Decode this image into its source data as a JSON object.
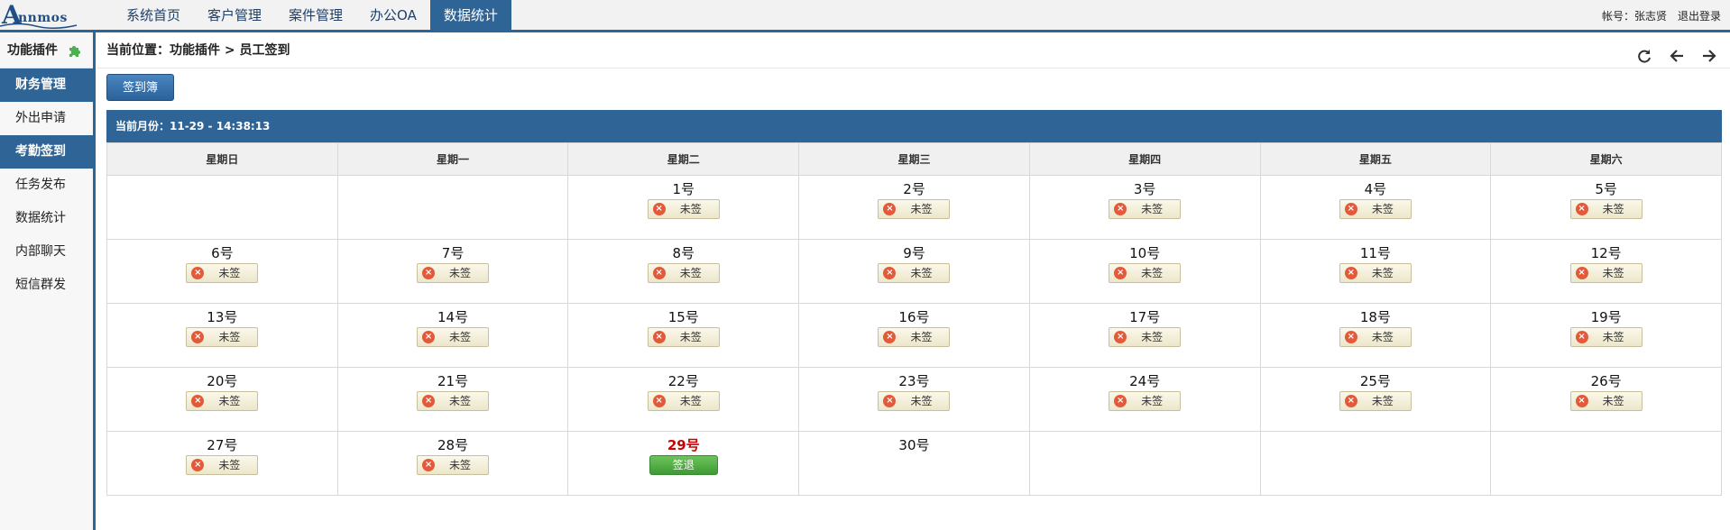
{
  "brand": {
    "logo_letter": "A",
    "logo_text": "nnmos"
  },
  "topnav": [
    {
      "label": "系统首页",
      "active": false
    },
    {
      "label": "客户管理",
      "active": false
    },
    {
      "label": "案件管理",
      "active": false
    },
    {
      "label": "办公OA",
      "active": false
    },
    {
      "label": "数据统计",
      "active": true
    }
  ],
  "account": {
    "user_label": "帐号：张志贤",
    "logout_label": "退出登录"
  },
  "sidebar": {
    "title": "功能插件",
    "items": [
      {
        "label": "财务管理",
        "header": true
      },
      {
        "label": "外出申请",
        "header": false
      },
      {
        "label": "考勤签到",
        "header": true
      },
      {
        "label": "任务发布",
        "header": false
      },
      {
        "label": "数据统计",
        "header": false
      },
      {
        "label": "内部聊天",
        "header": false
      },
      {
        "label": "短信群发",
        "header": false
      }
    ]
  },
  "breadcrumb": "当前位置：功能插件 > 员工签到",
  "sign_button_label": "签到簿",
  "calendar": {
    "header": "当前月份：11-29 - 14:38:13",
    "weekdays": [
      "星期日",
      "星期一",
      "星期二",
      "星期三",
      "星期四",
      "星期五",
      "星期六"
    ],
    "status_unsigned": "未签",
    "signout_label": "签退",
    "weeks": [
      [
        null,
        null,
        {
          "day": "1号",
          "status": "unsigned"
        },
        {
          "day": "2号",
          "status": "unsigned"
        },
        {
          "day": "3号",
          "status": "unsigned"
        },
        {
          "day": "4号",
          "status": "unsigned"
        },
        {
          "day": "5号",
          "status": "unsigned"
        }
      ],
      [
        {
          "day": "6号",
          "status": "unsigned"
        },
        {
          "day": "7号",
          "status": "unsigned"
        },
        {
          "day": "8号",
          "status": "unsigned"
        },
        {
          "day": "9号",
          "status": "unsigned"
        },
        {
          "day": "10号",
          "status": "unsigned"
        },
        {
          "day": "11号",
          "status": "unsigned"
        },
        {
          "day": "12号",
          "status": "unsigned"
        }
      ],
      [
        {
          "day": "13号",
          "status": "unsigned"
        },
        {
          "day": "14号",
          "status": "unsigned"
        },
        {
          "day": "15号",
          "status": "unsigned"
        },
        {
          "day": "16号",
          "status": "unsigned"
        },
        {
          "day": "17号",
          "status": "unsigned"
        },
        {
          "day": "18号",
          "status": "unsigned"
        },
        {
          "day": "19号",
          "status": "unsigned"
        }
      ],
      [
        {
          "day": "20号",
          "status": "unsigned"
        },
        {
          "day": "21号",
          "status": "unsigned"
        },
        {
          "day": "22号",
          "status": "unsigned"
        },
        {
          "day": "23号",
          "status": "unsigned"
        },
        {
          "day": "24号",
          "status": "unsigned"
        },
        {
          "day": "25号",
          "status": "unsigned"
        },
        {
          "day": "26号",
          "status": "unsigned"
        }
      ],
      [
        {
          "day": "27号",
          "status": "unsigned"
        },
        {
          "day": "28号",
          "status": "unsigned"
        },
        {
          "day": "29号",
          "status": "signout",
          "today": true
        },
        {
          "day": "30号",
          "status": "none"
        },
        null,
        null,
        null
      ]
    ]
  },
  "colors": {
    "accent": "#2f6496",
    "today": "#cc0000",
    "signout": "#4caf50",
    "unsigned_icon": "#e25a3a"
  }
}
